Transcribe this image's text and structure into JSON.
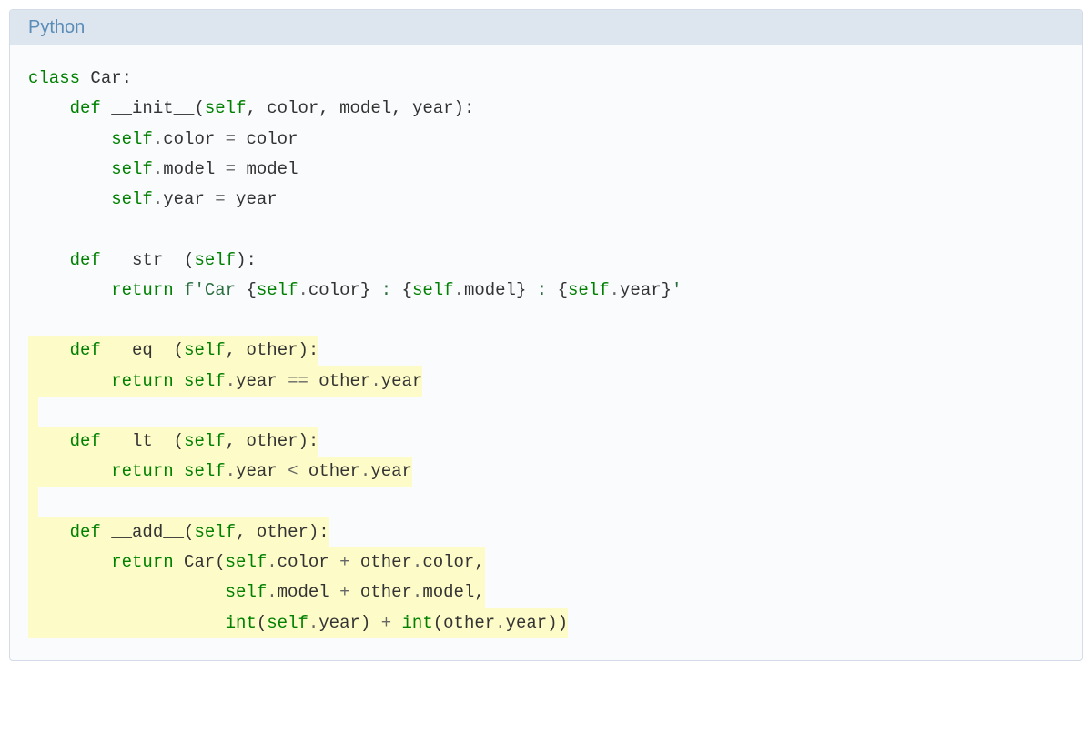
{
  "header": {
    "language": "Python"
  },
  "code": {
    "lines": [
      {
        "hl": false,
        "tokens": [
          {
            "c": "kw",
            "t": "class"
          },
          {
            "c": "name",
            "t": " Car"
          },
          {
            "c": "punct",
            "t": ":"
          }
        ]
      },
      {
        "hl": false,
        "tokens": [
          {
            "c": "name",
            "t": "    "
          },
          {
            "c": "kw",
            "t": "def"
          },
          {
            "c": "name",
            "t": " __init__"
          },
          {
            "c": "punct",
            "t": "("
          },
          {
            "c": "self",
            "t": "self"
          },
          {
            "c": "punct",
            "t": ", "
          },
          {
            "c": "name",
            "t": "color"
          },
          {
            "c": "punct",
            "t": ", "
          },
          {
            "c": "name",
            "t": "model"
          },
          {
            "c": "punct",
            "t": ", "
          },
          {
            "c": "name",
            "t": "year"
          },
          {
            "c": "punct",
            "t": "):"
          }
        ]
      },
      {
        "hl": false,
        "tokens": [
          {
            "c": "name",
            "t": "        "
          },
          {
            "c": "self",
            "t": "self"
          },
          {
            "c": "op",
            "t": "."
          },
          {
            "c": "name",
            "t": "color "
          },
          {
            "c": "op",
            "t": "="
          },
          {
            "c": "name",
            "t": " color"
          }
        ]
      },
      {
        "hl": false,
        "tokens": [
          {
            "c": "name",
            "t": "        "
          },
          {
            "c": "self",
            "t": "self"
          },
          {
            "c": "op",
            "t": "."
          },
          {
            "c": "name",
            "t": "model "
          },
          {
            "c": "op",
            "t": "="
          },
          {
            "c": "name",
            "t": " model"
          }
        ]
      },
      {
        "hl": false,
        "tokens": [
          {
            "c": "name",
            "t": "        "
          },
          {
            "c": "self",
            "t": "self"
          },
          {
            "c": "op",
            "t": "."
          },
          {
            "c": "name",
            "t": "year "
          },
          {
            "c": "op",
            "t": "="
          },
          {
            "c": "name",
            "t": " year"
          }
        ]
      },
      {
        "hl": false,
        "tokens": []
      },
      {
        "hl": false,
        "tokens": [
          {
            "c": "name",
            "t": "    "
          },
          {
            "c": "kw",
            "t": "def"
          },
          {
            "c": "name",
            "t": " __str__"
          },
          {
            "c": "punct",
            "t": "("
          },
          {
            "c": "self",
            "t": "self"
          },
          {
            "c": "punct",
            "t": "):"
          }
        ]
      },
      {
        "hl": false,
        "tokens": [
          {
            "c": "name",
            "t": "        "
          },
          {
            "c": "kw",
            "t": "return"
          },
          {
            "c": "name",
            "t": " "
          },
          {
            "c": "fstr",
            "t": "f'Car "
          },
          {
            "c": "punct",
            "t": "{"
          },
          {
            "c": "self",
            "t": "self"
          },
          {
            "c": "op",
            "t": "."
          },
          {
            "c": "name",
            "t": "color"
          },
          {
            "c": "punct",
            "t": "}"
          },
          {
            "c": "fstr",
            "t": " : "
          },
          {
            "c": "punct",
            "t": "{"
          },
          {
            "c": "self",
            "t": "self"
          },
          {
            "c": "op",
            "t": "."
          },
          {
            "c": "name",
            "t": "model"
          },
          {
            "c": "punct",
            "t": "}"
          },
          {
            "c": "fstr",
            "t": " : "
          },
          {
            "c": "punct",
            "t": "{"
          },
          {
            "c": "self",
            "t": "self"
          },
          {
            "c": "op",
            "t": "."
          },
          {
            "c": "name",
            "t": "year"
          },
          {
            "c": "punct",
            "t": "}"
          },
          {
            "c": "fstr",
            "t": "'"
          }
        ]
      },
      {
        "hl": false,
        "tokens": []
      },
      {
        "hl": true,
        "tokens": [
          {
            "c": "name",
            "t": "    "
          },
          {
            "c": "kw",
            "t": "def"
          },
          {
            "c": "name",
            "t": " __eq__"
          },
          {
            "c": "punct",
            "t": "("
          },
          {
            "c": "self",
            "t": "self"
          },
          {
            "c": "punct",
            "t": ", "
          },
          {
            "c": "name",
            "t": "other"
          },
          {
            "c": "punct",
            "t": "):"
          }
        ]
      },
      {
        "hl": true,
        "tokens": [
          {
            "c": "name",
            "t": "        "
          },
          {
            "c": "kw",
            "t": "return"
          },
          {
            "c": "name",
            "t": " "
          },
          {
            "c": "self",
            "t": "self"
          },
          {
            "c": "op",
            "t": "."
          },
          {
            "c": "name",
            "t": "year "
          },
          {
            "c": "op",
            "t": "=="
          },
          {
            "c": "name",
            "t": " other"
          },
          {
            "c": "op",
            "t": "."
          },
          {
            "c": "name",
            "t": "year"
          }
        ]
      },
      {
        "hl": true,
        "tokens": []
      },
      {
        "hl": true,
        "tokens": [
          {
            "c": "name",
            "t": "    "
          },
          {
            "c": "kw",
            "t": "def"
          },
          {
            "c": "name",
            "t": " __lt__"
          },
          {
            "c": "punct",
            "t": "("
          },
          {
            "c": "self",
            "t": "self"
          },
          {
            "c": "punct",
            "t": ", "
          },
          {
            "c": "name",
            "t": "other"
          },
          {
            "c": "punct",
            "t": "):"
          }
        ]
      },
      {
        "hl": true,
        "tokens": [
          {
            "c": "name",
            "t": "        "
          },
          {
            "c": "kw",
            "t": "return"
          },
          {
            "c": "name",
            "t": " "
          },
          {
            "c": "self",
            "t": "self"
          },
          {
            "c": "op",
            "t": "."
          },
          {
            "c": "name",
            "t": "year "
          },
          {
            "c": "op",
            "t": "<"
          },
          {
            "c": "name",
            "t": " other"
          },
          {
            "c": "op",
            "t": "."
          },
          {
            "c": "name",
            "t": "year"
          }
        ]
      },
      {
        "hl": true,
        "tokens": []
      },
      {
        "hl": true,
        "tokens": [
          {
            "c": "name",
            "t": "    "
          },
          {
            "c": "kw",
            "t": "def"
          },
          {
            "c": "name",
            "t": " __add__"
          },
          {
            "c": "punct",
            "t": "("
          },
          {
            "c": "self",
            "t": "self"
          },
          {
            "c": "punct",
            "t": ", "
          },
          {
            "c": "name",
            "t": "other"
          },
          {
            "c": "punct",
            "t": "):"
          }
        ]
      },
      {
        "hl": true,
        "tokens": [
          {
            "c": "name",
            "t": "        "
          },
          {
            "c": "kw",
            "t": "return"
          },
          {
            "c": "name",
            "t": " Car"
          },
          {
            "c": "punct",
            "t": "("
          },
          {
            "c": "self",
            "t": "self"
          },
          {
            "c": "op",
            "t": "."
          },
          {
            "c": "name",
            "t": "color "
          },
          {
            "c": "op",
            "t": "+"
          },
          {
            "c": "name",
            "t": " other"
          },
          {
            "c": "op",
            "t": "."
          },
          {
            "c": "name",
            "t": "color"
          },
          {
            "c": "punct",
            "t": ","
          }
        ]
      },
      {
        "hl": true,
        "tokens": [
          {
            "c": "name",
            "t": "                   "
          },
          {
            "c": "self",
            "t": "self"
          },
          {
            "c": "op",
            "t": "."
          },
          {
            "c": "name",
            "t": "model "
          },
          {
            "c": "op",
            "t": "+"
          },
          {
            "c": "name",
            "t": " other"
          },
          {
            "c": "op",
            "t": "."
          },
          {
            "c": "name",
            "t": "model"
          },
          {
            "c": "punct",
            "t": ","
          }
        ]
      },
      {
        "hl": true,
        "tokens": [
          {
            "c": "name",
            "t": "                   "
          },
          {
            "c": "builtin",
            "t": "int"
          },
          {
            "c": "punct",
            "t": "("
          },
          {
            "c": "self",
            "t": "self"
          },
          {
            "c": "op",
            "t": "."
          },
          {
            "c": "name",
            "t": "year"
          },
          {
            "c": "punct",
            "t": ") "
          },
          {
            "c": "op",
            "t": "+"
          },
          {
            "c": "name",
            "t": " "
          },
          {
            "c": "builtin",
            "t": "int"
          },
          {
            "c": "punct",
            "t": "("
          },
          {
            "c": "name",
            "t": "other"
          },
          {
            "c": "op",
            "t": "."
          },
          {
            "c": "name",
            "t": "year"
          },
          {
            "c": "punct",
            "t": "))"
          }
        ]
      }
    ]
  }
}
